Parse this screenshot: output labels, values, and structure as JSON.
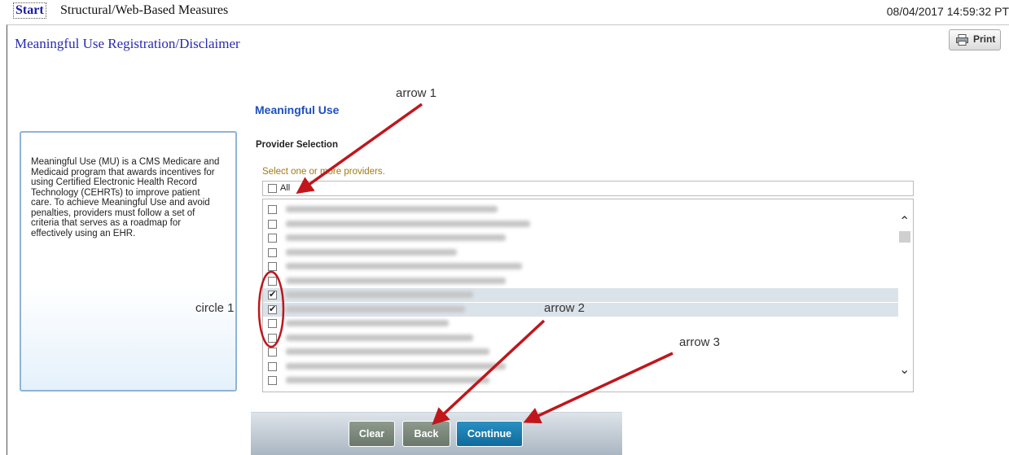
{
  "topbar": {
    "start_label": "Start",
    "breadcrumb": "Structural/Web-Based Measures",
    "timestamp": "08/04/2017 14:59:32 PT"
  },
  "page": {
    "title": "Meaningful Use Registration/Disclaimer",
    "print_label": "Print"
  },
  "info_box": {
    "text": "Meaningful Use (MU) is a CMS Medicare and Medicaid program that awards incentives for using Certified Electronic Health Record Technology (CEHRTs) to improve patient care. To achieve Meaningful Use and avoid penalties, providers must follow a set of criteria that serves as a roadmap for effectively using an EHR."
  },
  "main": {
    "section_title": "Meaningful Use",
    "provider_selection_label": "Provider Selection",
    "hint": "Select one or more providers.",
    "all_label": "All",
    "all_checked": false
  },
  "providers": [
    {
      "checked": false,
      "selected": false
    },
    {
      "checked": false,
      "selected": false
    },
    {
      "checked": false,
      "selected": false
    },
    {
      "checked": false,
      "selected": false
    },
    {
      "checked": false,
      "selected": false
    },
    {
      "checked": false,
      "selected": false
    },
    {
      "checked": true,
      "selected": true
    },
    {
      "checked": true,
      "selected": true
    },
    {
      "checked": false,
      "selected": false
    },
    {
      "checked": false,
      "selected": false
    },
    {
      "checked": false,
      "selected": false
    },
    {
      "checked": false,
      "selected": false
    },
    {
      "checked": false,
      "selected": false
    }
  ],
  "buttons": {
    "clear": "Clear",
    "back": "Back",
    "continue": "Continue"
  },
  "annotations": {
    "arrow1": "arrow 1",
    "arrow2": "arrow 2",
    "arrow3": "arrow 3",
    "circle1": "circle 1",
    "color": "#c0161c"
  },
  "colors": {
    "link": "#1a1aa6",
    "section_title": "#1f4fbf",
    "continue_button": "#1779ac",
    "neutral_button": "#7b887b"
  }
}
